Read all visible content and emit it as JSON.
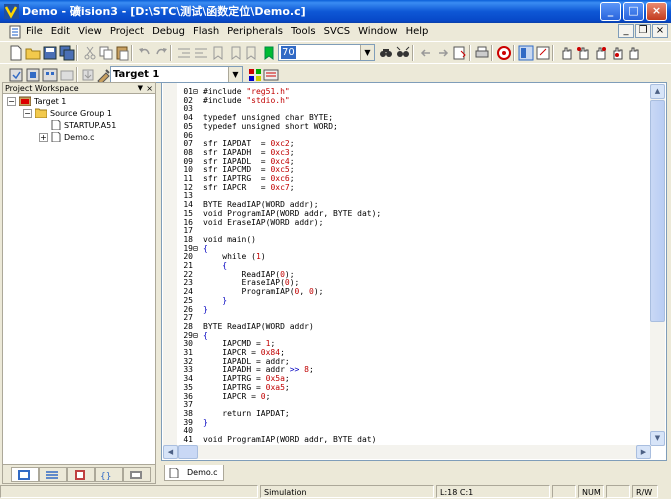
{
  "window": {
    "title": "Demo  - 礦ision3 - [D:\\STC\\测试\\函数定位\\Demo.c]",
    "minimize_label": "_",
    "maximize_label": "□",
    "close_label": "×"
  },
  "menu": {
    "items": [
      "File",
      "Edit",
      "View",
      "Project",
      "Debug",
      "Flash",
      "Peripherals",
      "Tools",
      "SVCS",
      "Window",
      "Help"
    ],
    "mdi_minimize": "_",
    "mdi_restore": "❐",
    "mdi_close": "×"
  },
  "toolbar": {
    "find_combo_value": "70",
    "target_combo_value": "Target 1"
  },
  "workspace": {
    "title": "Project Workspace",
    "pin_label": "▼",
    "close_label": "×",
    "tree": [
      {
        "label": "Target 1"
      },
      {
        "label": "Source Group 1"
      },
      {
        "label": "STARTUP.A51"
      },
      {
        "label": "Demo.c"
      }
    ]
  },
  "editor": {
    "lines": [
      {
        "n": "01",
        "fold": "⊟",
        "segs": [
          {
            "t": "#include ",
            "c": ""
          },
          {
            "t": "\"reg51.h\"",
            "c": "str"
          }
        ]
      },
      {
        "n": "02",
        "fold": "",
        "segs": [
          {
            "t": "#include ",
            "c": ""
          },
          {
            "t": "\"stdio.h\"",
            "c": "str"
          }
        ]
      },
      {
        "n": "03",
        "fold": "",
        "segs": []
      },
      {
        "n": "04",
        "fold": "",
        "segs": [
          {
            "t": "typedef unsigned char BYTE;",
            "c": ""
          }
        ]
      },
      {
        "n": "05",
        "fold": "",
        "segs": [
          {
            "t": "typedef unsigned short WORD;",
            "c": ""
          }
        ]
      },
      {
        "n": "06",
        "fold": "",
        "segs": []
      },
      {
        "n": "07",
        "fold": "",
        "segs": [
          {
            "t": "sfr IAPDAT  = ",
            "c": ""
          },
          {
            "t": "0xc2",
            "c": "str"
          },
          {
            "t": ";",
            "c": ""
          }
        ]
      },
      {
        "n": "08",
        "fold": "",
        "segs": [
          {
            "t": "sfr IAPADH  = ",
            "c": ""
          },
          {
            "t": "0xc3",
            "c": "str"
          },
          {
            "t": ";",
            "c": ""
          }
        ]
      },
      {
        "n": "09",
        "fold": "",
        "segs": [
          {
            "t": "sfr IAPADL  = ",
            "c": ""
          },
          {
            "t": "0xc4",
            "c": "str"
          },
          {
            "t": ";",
            "c": ""
          }
        ]
      },
      {
        "n": "10",
        "fold": "",
        "segs": [
          {
            "t": "sfr IAPCMD  = ",
            "c": ""
          },
          {
            "t": "0xc5",
            "c": "str"
          },
          {
            "t": ";",
            "c": ""
          }
        ]
      },
      {
        "n": "11",
        "fold": "",
        "segs": [
          {
            "t": "sfr IAPTRG  = ",
            "c": ""
          },
          {
            "t": "0xc6",
            "c": "str"
          },
          {
            "t": ";",
            "c": ""
          }
        ]
      },
      {
        "n": "12",
        "fold": "",
        "segs": [
          {
            "t": "sfr IAPCR   = ",
            "c": ""
          },
          {
            "t": "0xc7",
            "c": "str"
          },
          {
            "t": ";",
            "c": ""
          }
        ]
      },
      {
        "n": "13",
        "fold": "",
        "segs": []
      },
      {
        "n": "14",
        "fold": "",
        "segs": [
          {
            "t": "BYTE ReadIAP(WORD addr);",
            "c": ""
          }
        ]
      },
      {
        "n": "15",
        "fold": "",
        "segs": [
          {
            "t": "void ProgramIAP(WORD addr, BYTE dat);",
            "c": ""
          }
        ]
      },
      {
        "n": "16",
        "fold": "",
        "segs": [
          {
            "t": "void EraseIAP(WORD addr);",
            "c": ""
          }
        ]
      },
      {
        "n": "17",
        "fold": "",
        "segs": []
      },
      {
        "n": "18",
        "fold": "",
        "segs": [
          {
            "t": "void main()",
            "c": ""
          }
        ]
      },
      {
        "n": "19",
        "fold": "⊟",
        "segs": [
          {
            "t": "{",
            "c": "kw"
          }
        ]
      },
      {
        "n": "20",
        "fold": "",
        "segs": [
          {
            "t": "    while (",
            "c": ""
          },
          {
            "t": "1",
            "c": "str"
          },
          {
            "t": ")",
            "c": ""
          }
        ]
      },
      {
        "n": "21",
        "fold": "",
        "segs": [
          {
            "t": "    {",
            "c": "kw"
          }
        ]
      },
      {
        "n": "22",
        "fold": "",
        "segs": [
          {
            "t": "        ReadIAP(",
            "c": ""
          },
          {
            "t": "0",
            "c": "str"
          },
          {
            "t": ");",
            "c": ""
          }
        ]
      },
      {
        "n": "23",
        "fold": "",
        "segs": [
          {
            "t": "        EraseIAP(",
            "c": ""
          },
          {
            "t": "0",
            "c": "str"
          },
          {
            "t": ");",
            "c": ""
          }
        ]
      },
      {
        "n": "24",
        "fold": "",
        "segs": [
          {
            "t": "        ProgramIAP(",
            "c": ""
          },
          {
            "t": "0",
            "c": "str"
          },
          {
            "t": ", ",
            "c": ""
          },
          {
            "t": "0",
            "c": "str"
          },
          {
            "t": ");",
            "c": ""
          }
        ]
      },
      {
        "n": "25",
        "fold": "",
        "segs": [
          {
            "t": "    }",
            "c": "kw"
          }
        ]
      },
      {
        "n": "26",
        "fold": "",
        "segs": [
          {
            "t": "}",
            "c": "kw"
          }
        ]
      },
      {
        "n": "27",
        "fold": "",
        "segs": []
      },
      {
        "n": "28",
        "fold": "",
        "segs": [
          {
            "t": "BYTE ReadIAP(WORD addr)",
            "c": ""
          }
        ]
      },
      {
        "n": "29",
        "fold": "⊟",
        "segs": [
          {
            "t": "{",
            "c": "kw"
          }
        ]
      },
      {
        "n": "30",
        "fold": "",
        "segs": [
          {
            "t": "    IAPCMD = ",
            "c": ""
          },
          {
            "t": "1",
            "c": "str"
          },
          {
            "t": ";",
            "c": ""
          }
        ]
      },
      {
        "n": "31",
        "fold": "",
        "segs": [
          {
            "t": "    IAPCR = ",
            "c": ""
          },
          {
            "t": "0x84",
            "c": "str"
          },
          {
            "t": ";",
            "c": ""
          }
        ]
      },
      {
        "n": "32",
        "fold": "",
        "segs": [
          {
            "t": "    IAPADL = addr;",
            "c": ""
          }
        ]
      },
      {
        "n": "33",
        "fold": "",
        "segs": [
          {
            "t": "    IAPADH = addr ",
            "c": ""
          },
          {
            "t": ">>",
            "c": "kw"
          },
          {
            "t": " ",
            "c": ""
          },
          {
            "t": "8",
            "c": "str"
          },
          {
            "t": ";",
            "c": ""
          }
        ]
      },
      {
        "n": "34",
        "fold": "",
        "segs": [
          {
            "t": "    IAPTRG = ",
            "c": ""
          },
          {
            "t": "0x5a",
            "c": "str"
          },
          {
            "t": ";",
            "c": ""
          }
        ]
      },
      {
        "n": "35",
        "fold": "",
        "segs": [
          {
            "t": "    IAPTRG = ",
            "c": ""
          },
          {
            "t": "0xa5",
            "c": "str"
          },
          {
            "t": ";",
            "c": ""
          }
        ]
      },
      {
        "n": "36",
        "fold": "",
        "segs": [
          {
            "t": "    IAPCR = ",
            "c": ""
          },
          {
            "t": "0",
            "c": "str"
          },
          {
            "t": ";",
            "c": ""
          }
        ]
      },
      {
        "n": "37",
        "fold": "",
        "segs": []
      },
      {
        "n": "38",
        "fold": "",
        "segs": [
          {
            "t": "    return IAPDAT;",
            "c": ""
          }
        ]
      },
      {
        "n": "39",
        "fold": "",
        "segs": [
          {
            "t": "}",
            "c": "kw"
          }
        ]
      },
      {
        "n": "40",
        "fold": "",
        "segs": []
      },
      {
        "n": "41",
        "fold": "",
        "segs": [
          {
            "t": "void ProgramIAP(WORD addr, BYTE dat)",
            "c": ""
          }
        ]
      }
    ],
    "tab_label": "Demo.c"
  },
  "statusbar": {
    "mode": "Simulation",
    "position": "L:18 C:1",
    "num": "NUM",
    "rw": "R/W"
  },
  "colors": {
    "titlebar": "#0A5FD8",
    "keyword": "#0000C0",
    "string": "#C00000",
    "chrome": "#ECE9D8"
  }
}
